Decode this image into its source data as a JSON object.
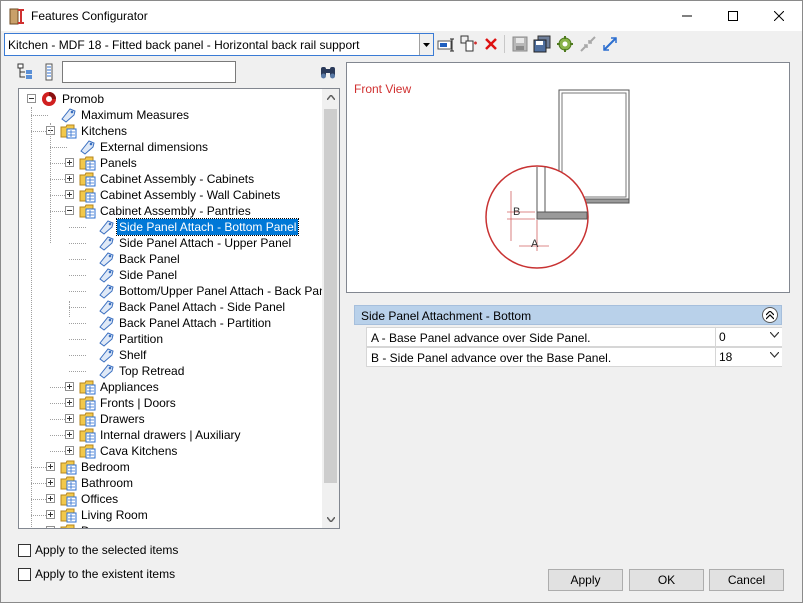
{
  "window": {
    "title": "Features Configurator"
  },
  "toolbar": {
    "selected_config": "Kitchen - MDF 18 - Fitted back panel - Horizontal back rail support"
  },
  "tree": {
    "search_value": "",
    "nodes": [
      {
        "label": "Promob",
        "icon": "promob-logo-icon"
      },
      {
        "label": "Maximum Measures",
        "icon": "tag-icon"
      },
      {
        "label": "Kitchens",
        "icon": "folder-grid-icon"
      },
      {
        "label": "External dimensions",
        "icon": "tag-icon"
      },
      {
        "label": "Panels",
        "icon": "folder-grid-icon"
      },
      {
        "label": "Cabinet Assembly - Cabinets",
        "icon": "folder-grid-icon"
      },
      {
        "label": "Cabinet Assembly - Wall Cabinets",
        "icon": "folder-grid-icon"
      },
      {
        "label": "Cabinet Assembly - Pantries",
        "icon": "folder-grid-icon"
      },
      {
        "label": "Side Panel Attach - Bottom Panel",
        "icon": "tag-icon"
      },
      {
        "label": " Side Panel Attach - Upper Panel",
        "icon": "tag-icon"
      },
      {
        "label": "Back Panel",
        "icon": "tag-icon"
      },
      {
        "label": "Side Panel",
        "icon": "tag-icon"
      },
      {
        "label": " Bottom/Upper Panel Attach - Back Panel",
        "icon": "tag-icon"
      },
      {
        "label": "Back Panel Attach - Side Panel",
        "icon": "tag-icon"
      },
      {
        "label": "Back Panel Attach - Partition",
        "icon": "tag-icon"
      },
      {
        "label": "Partition",
        "icon": "tag-icon"
      },
      {
        "label": "Shelf",
        "icon": "tag-icon"
      },
      {
        "label": "Top Retread",
        "icon": "tag-icon"
      },
      {
        "label": "Appliances",
        "icon": "folder-grid-icon"
      },
      {
        "label": "Fronts | Doors",
        "icon": "folder-grid-icon"
      },
      {
        "label": "Drawers",
        "icon": "folder-grid-icon"
      },
      {
        "label": "Internal drawers | Auxiliary",
        "icon": "folder-grid-icon"
      },
      {
        "label": "Cava Kitchens",
        "icon": "folder-grid-icon"
      },
      {
        "label": "Bedroom",
        "icon": "folder-grid-icon"
      },
      {
        "label": "Bathroom",
        "icon": "folder-grid-icon"
      },
      {
        "label": "Offices",
        "icon": "folder-grid-icon"
      },
      {
        "label": "Living Room",
        "icon": "folder-grid-icon"
      },
      {
        "label": "D...",
        "icon": "folder-grid-icon"
      }
    ]
  },
  "preview": {
    "title": "Front View",
    "label_a": "A",
    "label_b": "B",
    "accent": "#c83232"
  },
  "properties": {
    "group_title": "Side Panel Attachment - Bottom",
    "rows": [
      {
        "label": "A - Base Panel advance over Side Panel.",
        "value": "0"
      },
      {
        "label": "B - Side Panel advance over the Base Panel.",
        "value": "18"
      }
    ]
  },
  "options": {
    "apply_selected": "Apply to the selected items",
    "apply_existent": "Apply to the existent items"
  },
  "buttons": {
    "apply": "Apply",
    "ok": "OK",
    "cancel": "Cancel"
  }
}
